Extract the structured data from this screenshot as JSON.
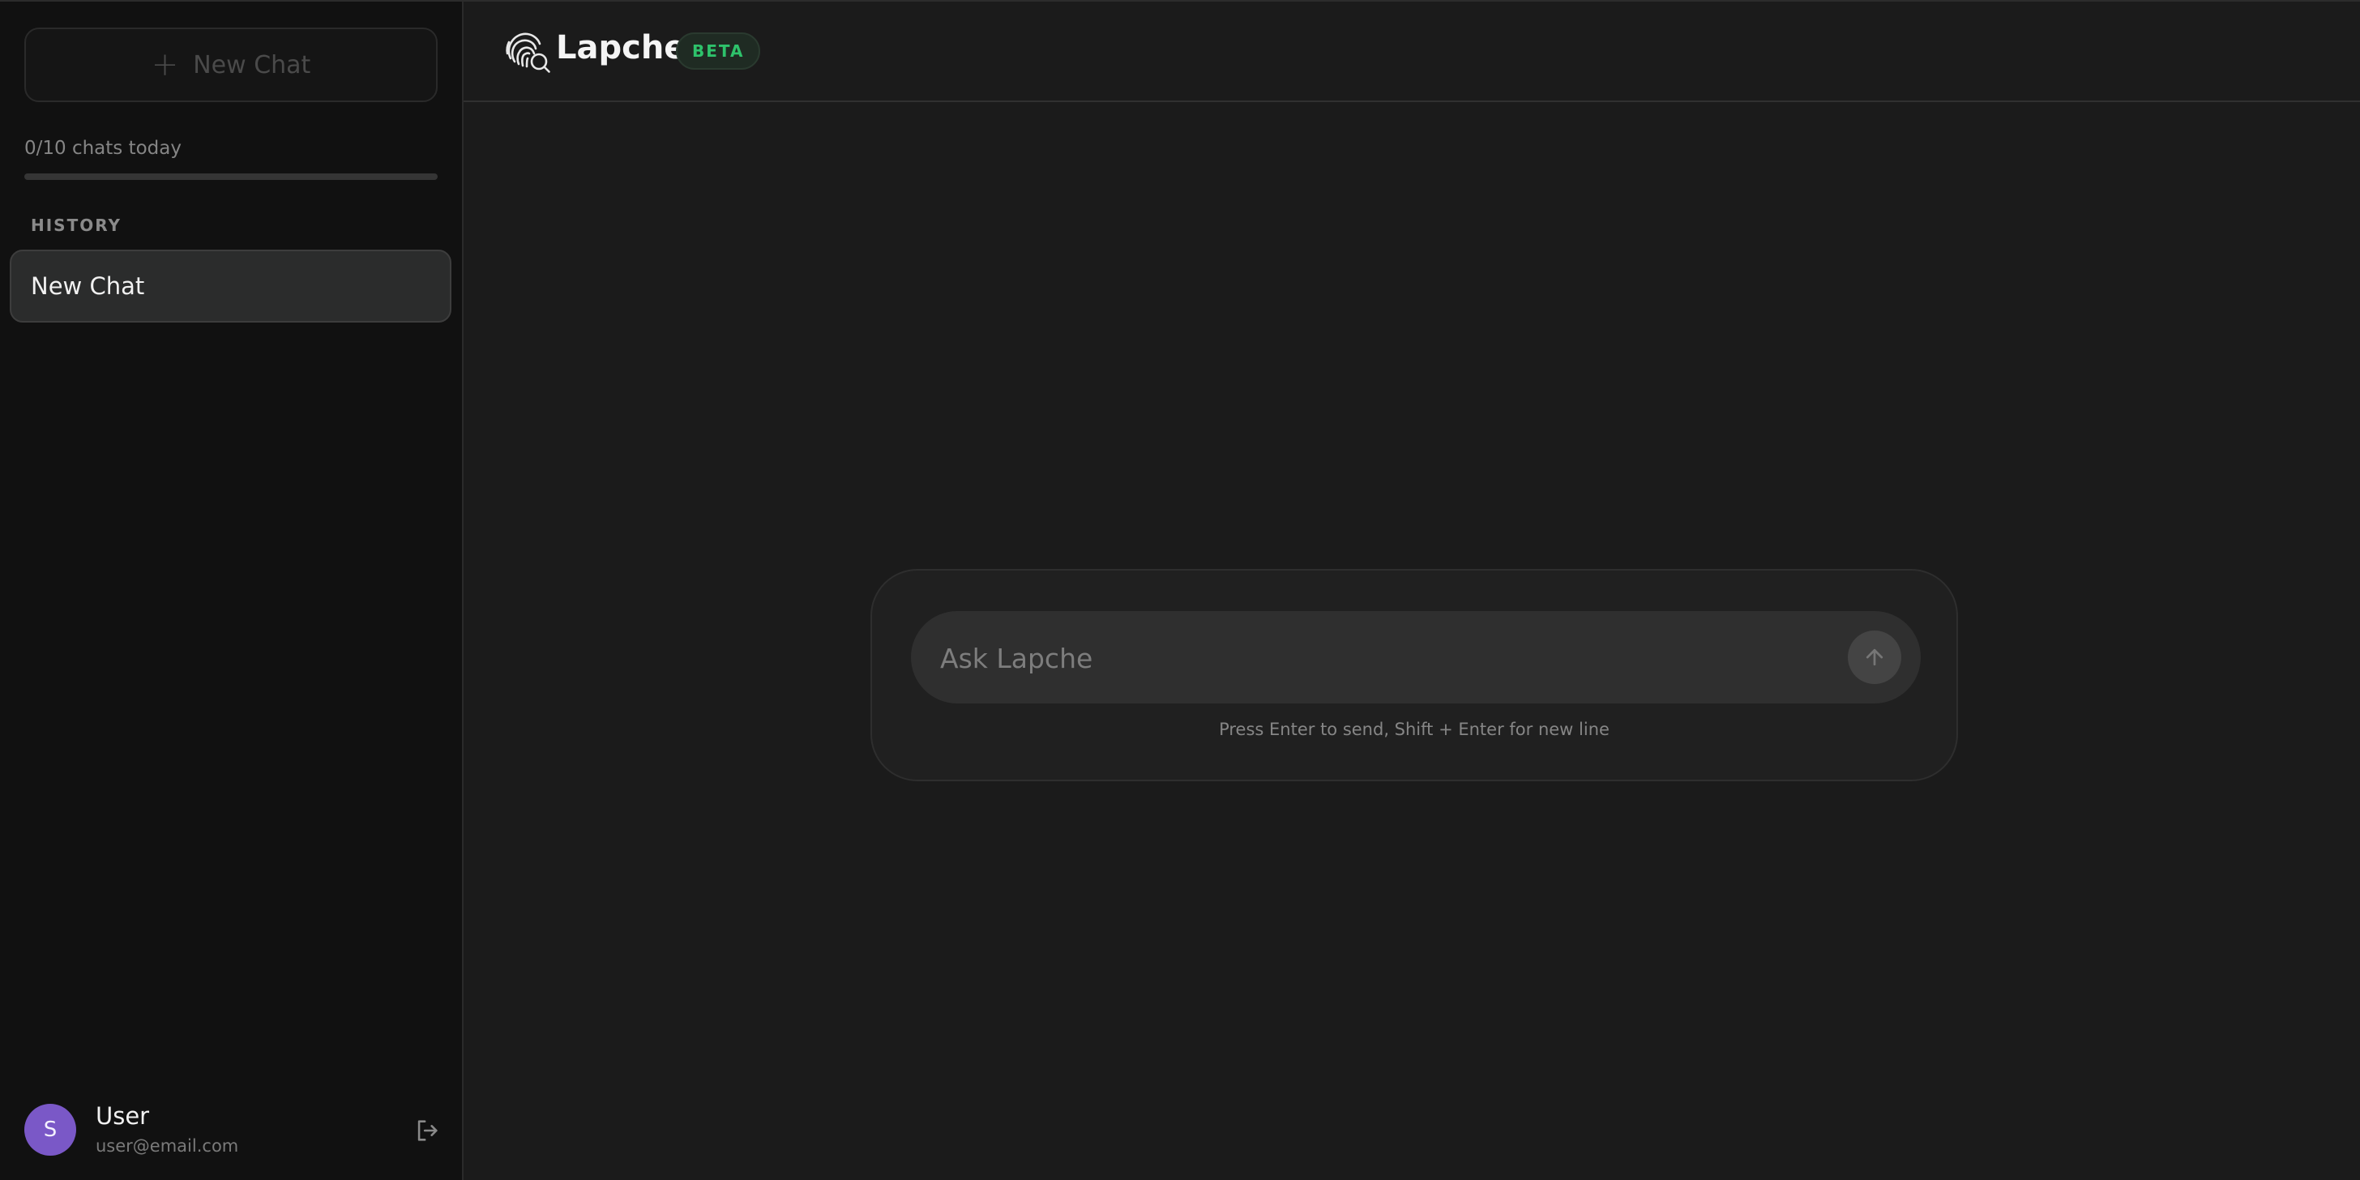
{
  "sidebar": {
    "new_chat_label": "New Chat",
    "usage_text": "0/10 chats today",
    "usage": {
      "used": 0,
      "limit": 10,
      "fraction": 0.0
    },
    "history_heading": "HISTORY",
    "history_items": [
      {
        "label": "New Chat"
      }
    ],
    "user": {
      "initial": "S",
      "name": "User",
      "email": "user@email.com"
    }
  },
  "header": {
    "brand": "Lapche",
    "badge": "BETA"
  },
  "composer": {
    "placeholder": "Ask Lapche",
    "hint": "Press Enter to send, Shift + Enter for new line"
  },
  "colors": {
    "accent_avatar": "#7a58c7",
    "badge_green": "#2ec26b",
    "sidebar_bg": "#111111",
    "main_bg": "#1b1b1b"
  },
  "icons": {
    "new_chat": "plus-icon",
    "logo": "fingerprint-search-icon",
    "send": "arrow-up-icon",
    "logout": "logout-icon"
  }
}
